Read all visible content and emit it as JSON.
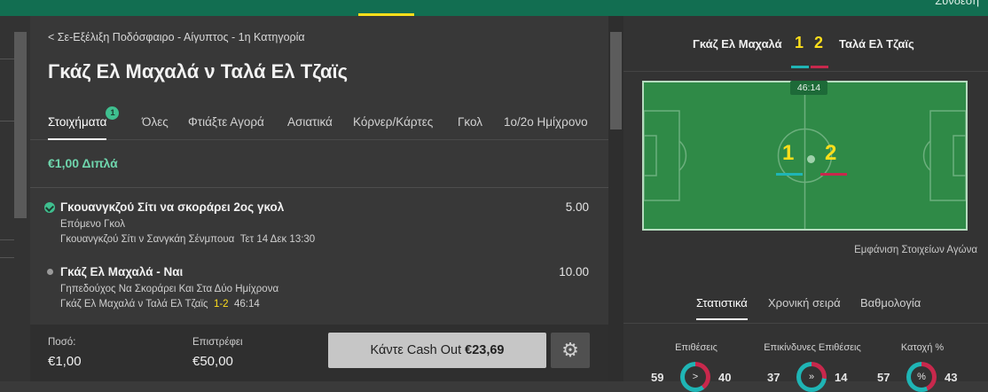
{
  "topbar": {
    "login_label": "Σύνδεση"
  },
  "breadcrumb": "< Σε-Εξέλιξη Ποδόσφαιρο - Αίγυπτος - 1η Κατηγορία",
  "title": "Γκάζ Ελ Μαχαλά ν Ταλά Ελ Τζαϊς",
  "tabs": [
    {
      "label": "Στοιχήματα",
      "badge": "1",
      "active": true
    },
    {
      "label": "Όλες"
    },
    {
      "label": "Φτιάξτε Αγορά"
    },
    {
      "label": "Ασιατικά"
    },
    {
      "label": "Κόρνερ/Κάρτες"
    },
    {
      "label": "Γκολ"
    },
    {
      "label": "1ο/2ο Ημίχρονο"
    }
  ],
  "bet": {
    "type_label": "€1,00 Διπλά",
    "selections": [
      {
        "name": "Γκουανγκζού Σίτι να σκοράρει 2ος γκολ",
        "odds": "5.00",
        "market": "Επόμενο Γκολ",
        "event": "Γκουανγκζού Σίτι ν Σανγκάη Σένμπουα",
        "time": "Τετ 14 Δεκ 13:30",
        "status": "won"
      },
      {
        "name": "Γκάζ Ελ Μαχαλά - Ναι",
        "odds": "10.00",
        "market": "Γηπεδούχος Να Σκοράρει Και Στα Δύο Ημίχρονα",
        "event": "Γκάζ Ελ Μαχαλά ν Ταλά Ελ Τζαϊς",
        "score": "1-2",
        "time": "46:14",
        "status": "open"
      }
    ],
    "stake_label": "Ποσό:",
    "stake_value": "€1,00",
    "returns_label": "Επιστρέφει",
    "returns_value": "€50,00",
    "cashout_label": "Κάντε Cash Out",
    "cashout_value": "€23,69"
  },
  "scoreboard": {
    "home": "Γκάζ Ελ Μαχαλά",
    "away": "Ταλά Ελ Τζαϊς",
    "home_score": "1",
    "away_score": "2",
    "clock": "46:14",
    "home_color": "#1fb5b5",
    "away_color": "#c8284c"
  },
  "show_details_label": "Εμφάνιση Στοιχείων Αγώνα",
  "stats_tabs": [
    {
      "label": "Στατιστικά",
      "active": true
    },
    {
      "label": "Χρονική σειρά"
    },
    {
      "label": "Βαθμολογία"
    }
  ],
  "stats": [
    {
      "label": "Επιθέσεις",
      "home": "59",
      "away": "40",
      "icon": ">"
    },
    {
      "label": "Επικίνδυνες Επιθέσεις",
      "home": "37",
      "away": "14",
      "icon": "»"
    },
    {
      "label": "Κατοχή %",
      "home": "57",
      "away": "43",
      "icon": "%"
    }
  ],
  "colors": {
    "accent": "#3fbf8f",
    "highlight": "#ffdf1b",
    "brand": "#126e51"
  }
}
